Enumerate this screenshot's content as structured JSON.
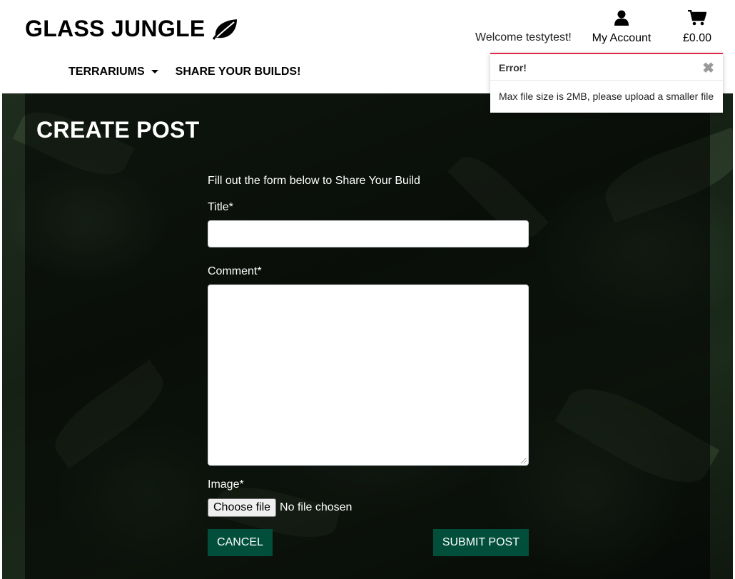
{
  "brand": {
    "name": "GLASS JUNGLE",
    "icon": "leaf-icon"
  },
  "nav": {
    "terrariums": "TERRARIUMS",
    "share": "SHARE YOUR BUILDS!"
  },
  "header": {
    "welcome": "Welcome testytest!",
    "account_label": "My Account",
    "cart_total": "£0.00"
  },
  "toast": {
    "title": "Error!",
    "close": "✖",
    "message": "Max file size is 2MB, please upload a smaller file",
    "accent": "#e02a4a"
  },
  "page": {
    "title": "CREATE POST",
    "intro": "Fill out the form below to Share Your Build"
  },
  "form": {
    "title_label": "Title*",
    "title_value": "",
    "comment_label": "Comment*",
    "comment_value": "",
    "image_label": "Image*",
    "file_button": "Choose file",
    "file_status": "No file chosen",
    "cancel": "CANCEL",
    "submit": "SUBMIT POST"
  },
  "colors": {
    "button_green": "#014f3a"
  }
}
